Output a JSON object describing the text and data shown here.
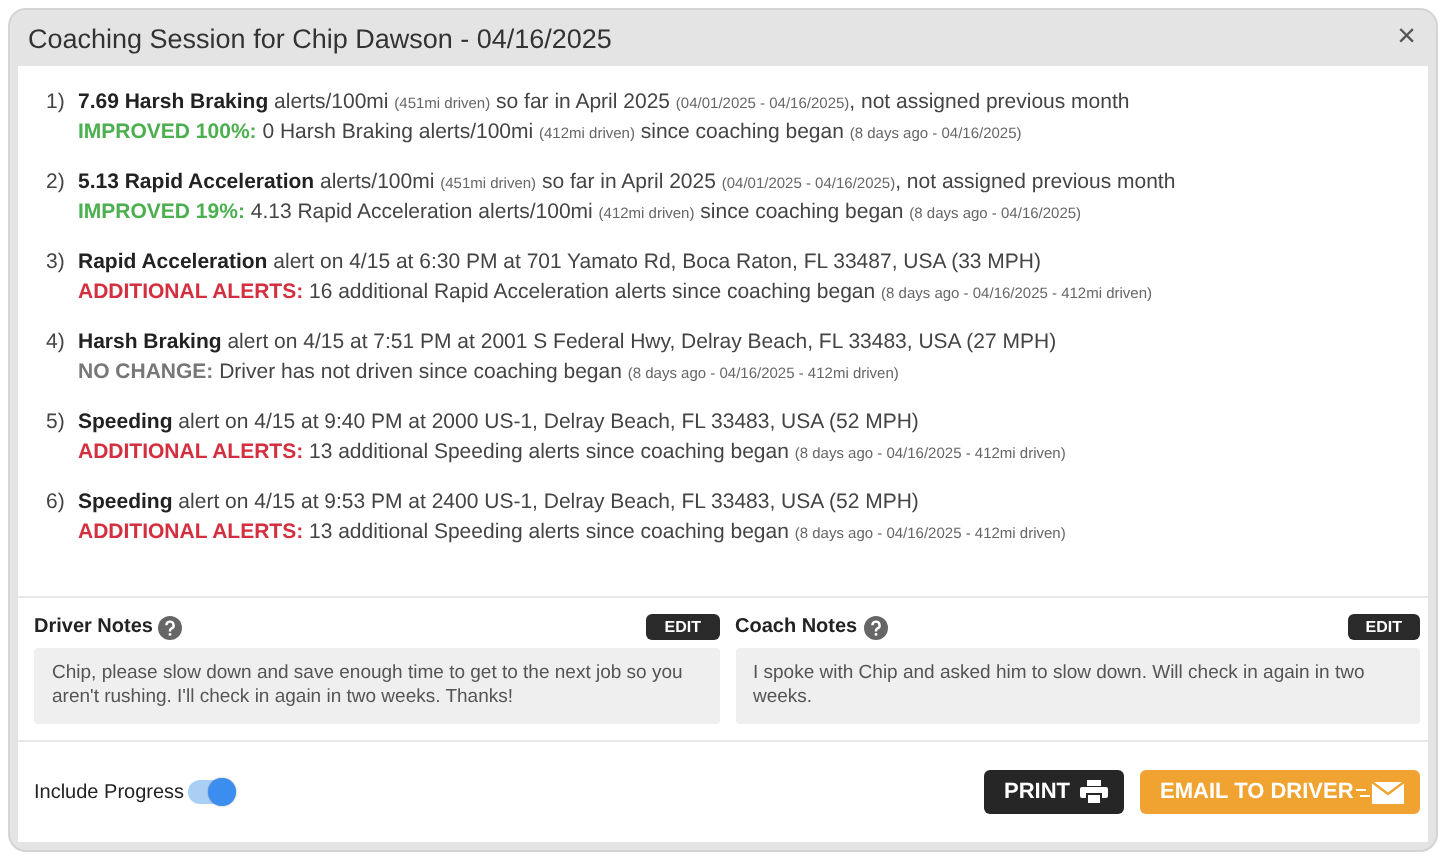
{
  "window": {
    "title": "Coaching Session for Chip Dawson - 04/16/2025",
    "close": "×"
  },
  "items": [
    {
      "number": "1)",
      "line": [
        {
          "kind": "bold",
          "text": "7.69 Harsh Braking"
        },
        {
          "kind": "normal",
          "text": " alerts/100mi "
        },
        {
          "kind": "small",
          "text": "(451mi driven)"
        },
        {
          "kind": "normal",
          "text": " so far in April 2025 "
        },
        {
          "kind": "small",
          "text": "(04/01/2025 - 04/16/2025)"
        },
        {
          "kind": "normal",
          "text": ", not assigned previous month"
        }
      ],
      "status": {
        "kind": "improved",
        "label": "IMPROVED 100%:",
        "parts": [
          {
            "kind": "normal",
            "text": " 0 Harsh Braking alerts/100mi "
          },
          {
            "kind": "small",
            "text": "(412mi driven)"
          },
          {
            "kind": "normal",
            "text": " since coaching began "
          },
          {
            "kind": "small",
            "text": "(8 days ago - 04/16/2025)"
          }
        ]
      }
    },
    {
      "number": "2)",
      "line": [
        {
          "kind": "bold",
          "text": "5.13 Rapid Acceleration"
        },
        {
          "kind": "normal",
          "text": " alerts/100mi "
        },
        {
          "kind": "small",
          "text": "(451mi driven)"
        },
        {
          "kind": "normal",
          "text": " so far in April 2025 "
        },
        {
          "kind": "small",
          "text": "(04/01/2025 - 04/16/2025)"
        },
        {
          "kind": "normal",
          "text": ", not assigned previous month"
        }
      ],
      "status": {
        "kind": "improved",
        "label": "IMPROVED 19%:",
        "parts": [
          {
            "kind": "normal",
            "text": " 4.13 Rapid Acceleration alerts/100mi "
          },
          {
            "kind": "small",
            "text": "(412mi driven)"
          },
          {
            "kind": "normal",
            "text": " since coaching began "
          },
          {
            "kind": "small",
            "text": "(8 days ago - 04/16/2025)"
          }
        ]
      }
    },
    {
      "number": "3)",
      "line": [
        {
          "kind": "bold",
          "text": "Rapid Acceleration"
        },
        {
          "kind": "normal",
          "text": " alert on 4/15 at 6:30 PM at 701 Yamato Rd, Boca Raton, FL 33487, USA (33 MPH)"
        }
      ],
      "status": {
        "kind": "additional",
        "label": "ADDITIONAL ALERTS:",
        "parts": [
          {
            "kind": "normal",
            "text": " 16 additional Rapid Acceleration alerts since coaching began "
          },
          {
            "kind": "small",
            "text": "(8 days ago - 04/16/2025 - 412mi driven)"
          }
        ]
      }
    },
    {
      "number": "4)",
      "line": [
        {
          "kind": "bold",
          "text": "Harsh Braking"
        },
        {
          "kind": "normal",
          "text": " alert on 4/15 at 7:51 PM at 2001 S Federal Hwy, Delray Beach, FL 33483, USA (27 MPH)"
        }
      ],
      "status": {
        "kind": "no_change",
        "label": "NO CHANGE:",
        "parts": [
          {
            "kind": "normal",
            "text": " Driver has not driven since coaching began "
          },
          {
            "kind": "small",
            "text": "(8 days ago - 04/16/2025 - 412mi driven)"
          }
        ]
      }
    },
    {
      "number": "5)",
      "line": [
        {
          "kind": "bold",
          "text": "Speeding"
        },
        {
          "kind": "normal",
          "text": " alert on 4/15 at 9:40 PM at 2000 US-1, Delray Beach, FL 33483, USA (52 MPH)"
        }
      ],
      "status": {
        "kind": "additional",
        "label": "ADDITIONAL ALERTS:",
        "parts": [
          {
            "kind": "normal",
            "text": " 13 additional Speeding alerts since coaching began "
          },
          {
            "kind": "small",
            "text": "(8 days ago - 04/16/2025 - 412mi driven)"
          }
        ]
      }
    },
    {
      "number": "6)",
      "line": [
        {
          "kind": "bold",
          "text": "Speeding"
        },
        {
          "kind": "normal",
          "text": " alert on 4/15 at 9:53 PM at 2400 US-1, Delray Beach, FL 33483, USA (52 MPH)"
        }
      ],
      "status": {
        "kind": "additional",
        "label": "ADDITIONAL ALERTS:",
        "parts": [
          {
            "kind": "normal",
            "text": " 13 additional Speeding alerts since coaching began "
          },
          {
            "kind": "small",
            "text": "(8 days ago - 04/16/2025 - 412mi driven)"
          }
        ]
      }
    }
  ],
  "notes": [
    {
      "title": "Driver Notes",
      "edit": "EDIT",
      "text": "Chip, please slow down and save enough time to get to the next job so you aren't rushing. I'll check in again in two weeks. Thanks!"
    },
    {
      "title": "Coach Notes",
      "edit": "EDIT",
      "text": "I spoke with Chip and asked him to slow down. Will check in again in two weeks."
    }
  ],
  "footer": {
    "toggle_label": "Include Progress",
    "toggle_on": true,
    "print": "PRINT",
    "email": "EMAIL TO DRIVER"
  }
}
